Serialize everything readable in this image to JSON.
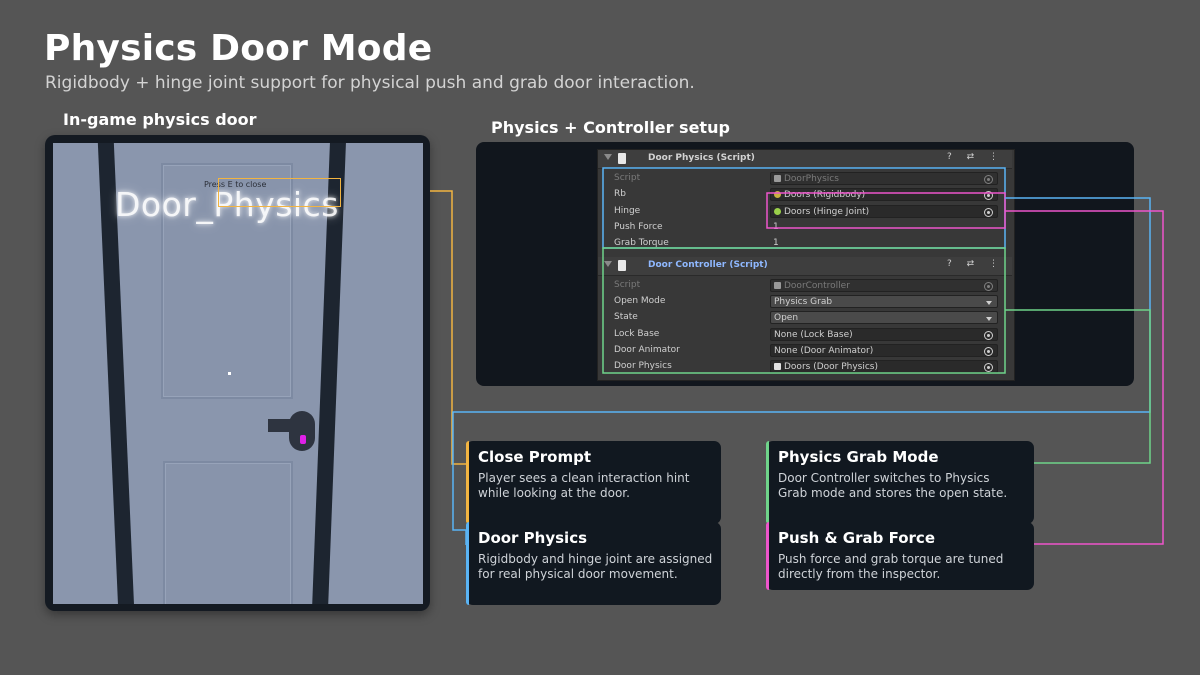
{
  "header": {
    "title": "Physics Door Mode",
    "subtitle": "Rigidbody + hinge joint support for physical push and grab door interaction."
  },
  "sections": {
    "left_label": "In-game physics door",
    "right_label": "Physics + Controller setup"
  },
  "game_view": {
    "door_name": "Door_Physics",
    "prompt": "Press E to close"
  },
  "inspector": {
    "door_physics": {
      "title": "Door Physics (Script)",
      "header_icons": "? ⇄ ⋮",
      "rows": [
        {
          "label": "Script",
          "value": "DoorPhysics"
        },
        {
          "label": "Rb",
          "value": "Doors  (Rigidbody)"
        },
        {
          "label": "Hinge",
          "value": "Doors  (Hinge Joint)"
        },
        {
          "label": "Push Force",
          "value": "1"
        },
        {
          "label": "Grab Torque",
          "value": "1"
        }
      ]
    },
    "door_controller": {
      "title": "Door Controller (Script)",
      "header_icons": "? ⇄ ⋮",
      "rows": [
        {
          "label": "Script",
          "value": "DoorController"
        },
        {
          "label": "Open Mode",
          "value": "Physics Grab"
        },
        {
          "label": "State",
          "value": "Open"
        },
        {
          "label": "Lock Base",
          "value": "None (Lock Base)"
        },
        {
          "label": "Door Animator",
          "value": "None (Door Animator)"
        },
        {
          "label": "Door Physics",
          "value": "Doors  (Door Physics)"
        }
      ]
    }
  },
  "cards": [
    {
      "title": "Close Prompt",
      "body": "Player sees a clean interaction hint while looking at the door.",
      "color": "#f2b441"
    },
    {
      "title": "Door Physics",
      "body": "Rigidbody and hinge joint are assigned for real physical door movement.",
      "color": "#5ab4f5"
    },
    {
      "title": "Physics Grab Mode",
      "body": "Door Controller switches to Physics Grab mode and stores the open state.",
      "color": "#6fd48a"
    },
    {
      "title": "Push & Grab Force",
      "body": "Push force and grab torque are tuned directly from the inspector.",
      "color": "#ee55cc"
    }
  ],
  "colors": {
    "background": "#555555",
    "yellow": "#f2b441",
    "blue": "#5ab4f5",
    "green": "#6fd48a",
    "magenta": "#ee55cc"
  }
}
